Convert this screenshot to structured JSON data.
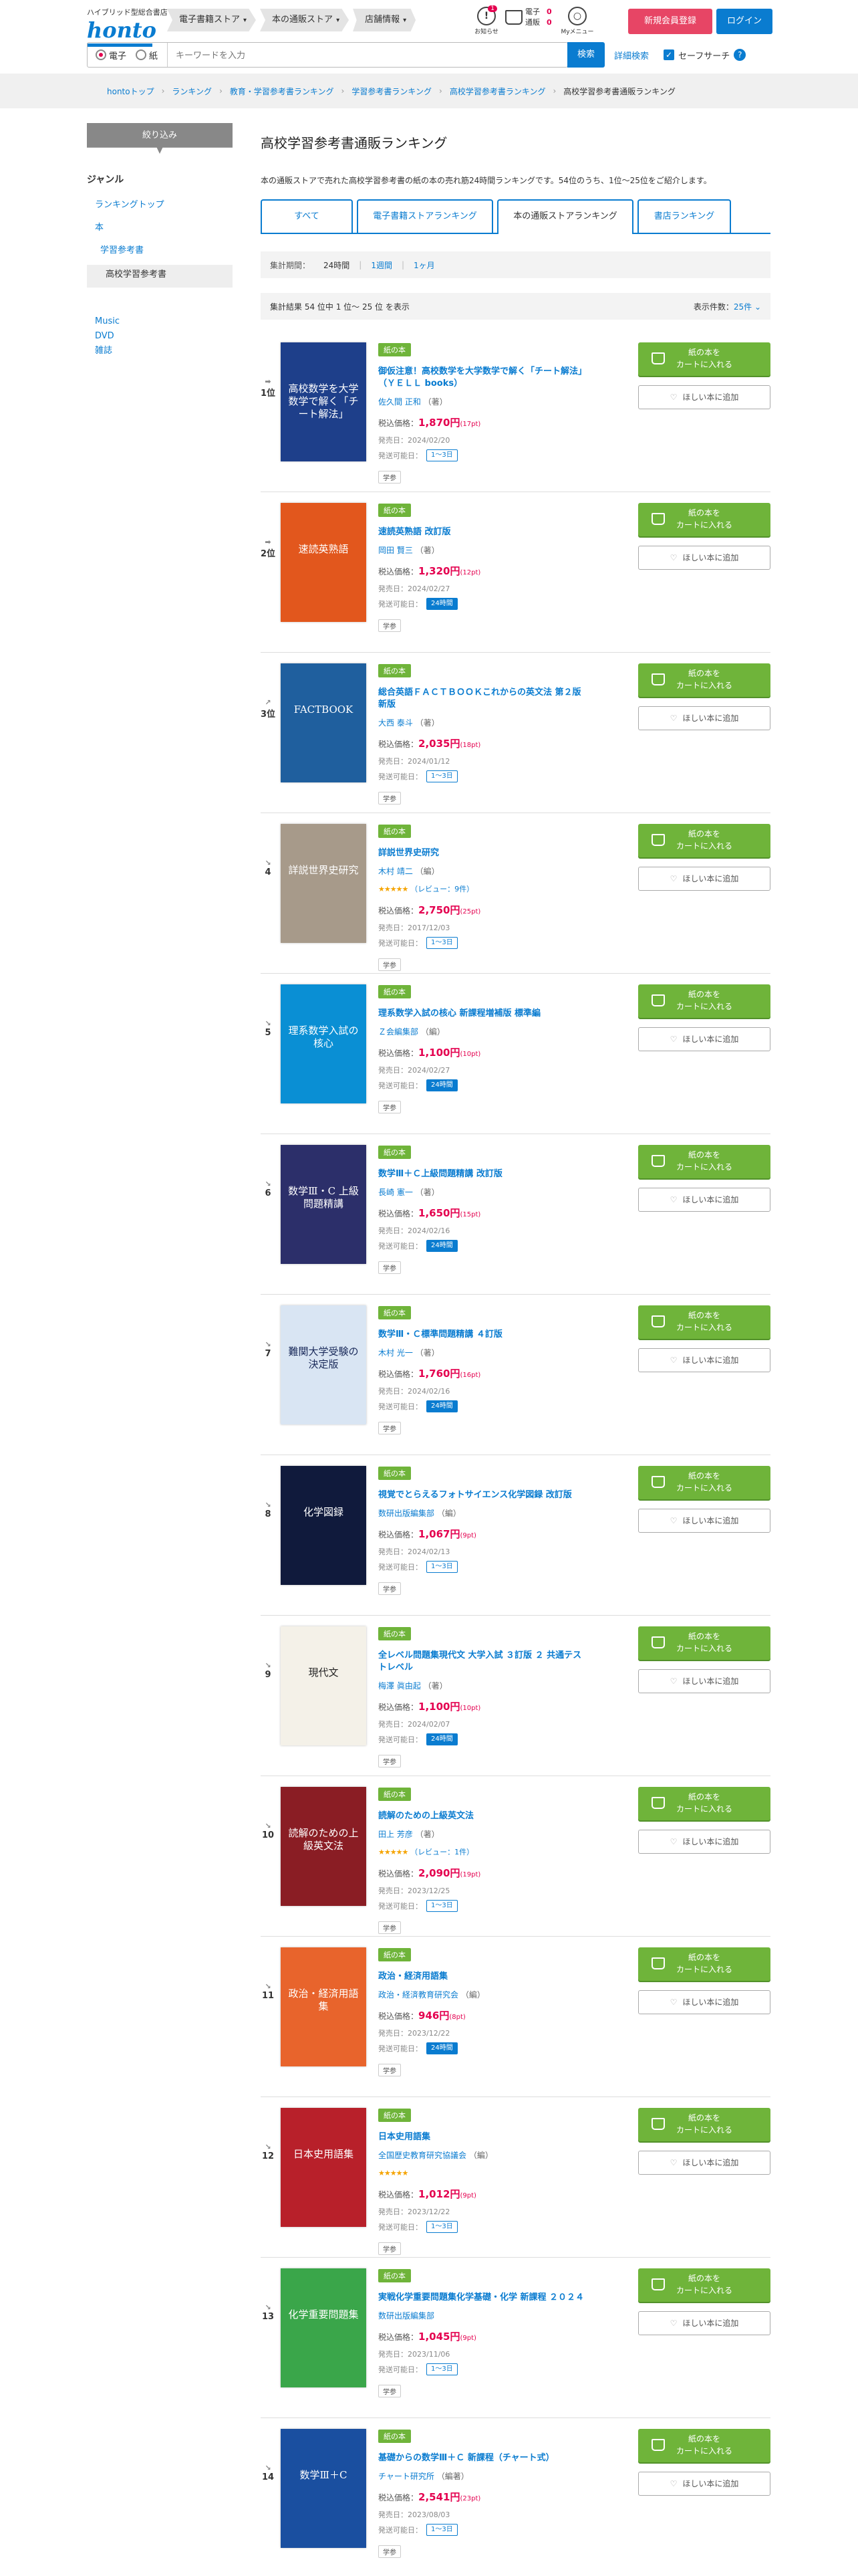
{
  "header": {
    "tagline": "ハイブリッド型総合書店",
    "logo": "honto",
    "tabs": [
      "電子書籍ストア",
      "本の通販ストア",
      "店舗情報"
    ],
    "notice_label": "お知らせ",
    "notice_count": "1",
    "cart_label_1": "電子",
    "cart_label_2": "通販",
    "cart_count_1": "0",
    "cart_count_2": "0",
    "mymenu_label": "Myメニュー",
    "register": "新規会員登録",
    "login": "ログイン",
    "radio_1": "電子",
    "radio_2": "紙",
    "search_placeholder": "キーワードを入力",
    "search_button": "検索",
    "advanced": "詳細検索",
    "safe_search": "セーフサーチ",
    "help": "?"
  },
  "breadcrumb": [
    "hontoトップ",
    "ランキング",
    "教育・学習参考書ランキング",
    "学習参考書ランキング",
    "高校学習参考書ランキング",
    "高校学習参考書通販ランキング"
  ],
  "sidebar": {
    "narrow": "絞り込み",
    "genre": "ジャンル",
    "top": "ランキングトップ",
    "book": "本",
    "study": "学習参考書",
    "current": "高校学習参考書",
    "music": "Music",
    "dvd": "DVD",
    "magazine": "雑誌"
  },
  "main": {
    "title": "高校学習参考書通販ランキング",
    "intro": "本の通販ストアで売れた高校学習参考書の紙の本の売れ筋24時間ランキングです。54位のうち、1位〜25位をご紹介します。",
    "tabs": [
      "すべて",
      "電子書籍ストアランキング",
      "本の通販ストアランキング",
      "書店ランキング"
    ],
    "period_label": "集計期間：",
    "period_current": "24時間",
    "period_week": "1週間",
    "period_month": "1ヶ月",
    "count_text": "集計結果 54 位中 1 位〜 25 位 を表示",
    "display_label": "表示件数：",
    "display_value": "25件"
  },
  "labels": {
    "paper": "紙の本",
    "cart_1": "紙の本を",
    "cart_2": "カートに入れる",
    "wish": "ほしい本に追加",
    "price": "税込価格：",
    "release": "発売日：",
    "ship": "発送可能日：",
    "tag": "学参"
  },
  "items": [
    {
      "rank": "1位",
      "arrow": "➡",
      "title": "御仮注意！高校数学を大学数学で解く「チート解法」（ＹＥＬＬ books）",
      "author": "佐久間 正和",
      "role": "（著）",
      "price": "1,870円",
      "pt": "(17pt)",
      "date": "2024/02/20",
      "ship": "1〜3日",
      "fast": false,
      "cover_bg": "#1e3f8a",
      "cover_text": "高校数学を大学数学で解く「チート解法」",
      "cover_fg": "#ffffff"
    },
    {
      "rank": "2位",
      "arrow": "➡",
      "title": "速読英熟語 改訂版",
      "author": "岡田 賢三",
      "role": "（著）",
      "price": "1,320円",
      "pt": "(12pt)",
      "date": "2024/02/27",
      "ship": "24時間",
      "fast": true,
      "cover_bg": "#e2571d",
      "cover_text": "速読英熟語",
      "cover_fg": "#ffffff"
    },
    {
      "rank": "3位",
      "arrow": "↗",
      "title": "総合英語ＦＡＣＴＢＯＯＫこれからの英文法 第２版新版",
      "author": "大西 泰斗",
      "role": "（著）",
      "price": "2,035円",
      "pt": "(18pt)",
      "date": "2024/01/12",
      "ship": "1〜3日",
      "fast": false,
      "cover_bg": "#1f5f9e",
      "cover_text": "FACTBOOK",
      "cover_fg": "#ffffff"
    },
    {
      "rank": "4",
      "arrow": "↘",
      "title": "詳説世界史研究",
      "author": "木村 靖二",
      "role": "（編）",
      "review": "（レビュー：9件）",
      "price": "2,750円",
      "pt": "(25pt)",
      "date": "2017/12/03",
      "ship": "1〜3日",
      "fast": false,
      "cover_bg": "#a79a8a",
      "cover_text": "詳説世界史研究",
      "cover_fg": "#ffffff"
    },
    {
      "rank": "5",
      "arrow": "↘",
      "title": "理系数学入試の核心 新課程増補版 標準編",
      "author": "Ｚ会編集部",
      "role": "（編）",
      "price": "1,100円",
      "pt": "(10pt)",
      "date": "2024/02/27",
      "ship": "24時間",
      "fast": true,
      "cover_bg": "#0a8fd4",
      "cover_text": "理系数学入試の核心",
      "cover_fg": "#ffffff"
    },
    {
      "rank": "6",
      "arrow": "↘",
      "title": "数学Ⅲ＋Ｃ上級問題精講 改訂版",
      "author": "長崎 憲一",
      "role": "（著）",
      "price": "1,650円",
      "pt": "(15pt)",
      "date": "2024/02/16",
      "ship": "24時間",
      "fast": true,
      "cover_bg": "#2c2f6a",
      "cover_text": "数学Ⅲ・C 上級問題精講",
      "cover_fg": "#ffffff"
    },
    {
      "rank": "7",
      "arrow": "↘",
      "title": "数学Ⅲ・Ｃ標準問題精講 ４訂版",
      "author": "木村 光一",
      "role": "（著）",
      "price": "1,760円",
      "pt": "(16pt)",
      "date": "2024/02/16",
      "ship": "24時間",
      "fast": true,
      "cover_bg": "#d9e5f3",
      "cover_text": "難関大学受験の決定版",
      "cover_fg": "#1a2a5a"
    },
    {
      "rank": "8",
      "arrow": "↘",
      "title": "視覚でとらえるフォトサイエンス化学図録 改訂版",
      "author": "数研出版編集部",
      "role": "（編）",
      "price": "1,067円",
      "pt": "(9pt)",
      "date": "2024/02/13",
      "ship": "1〜3日",
      "fast": false,
      "cover_bg": "#101a3c",
      "cover_text": "化学図録",
      "cover_fg": "#ffffff"
    },
    {
      "rank": "9",
      "arrow": "↘",
      "title": "全レベル問題集現代文 大学入試 ３訂版 ２ 共通テストレベル",
      "author": "梅澤 眞由起",
      "role": "（著）",
      "price": "1,100円",
      "pt": "(10pt)",
      "date": "2024/02/07",
      "ship": "24時間",
      "fast": true,
      "cover_bg": "#f4f1e8",
      "cover_text": "現代文",
      "cover_fg": "#222222"
    },
    {
      "rank": "10",
      "arrow": "↘",
      "title": "読解のための上級英文法",
      "author": "田上 芳彦",
      "role": "（著）",
      "review": "（レビュー：1件）",
      "price": "2,090円",
      "pt": "(19pt)",
      "date": "2023/12/25",
      "ship": "1〜3日",
      "fast": false,
      "cover_bg": "#8a1d24",
      "cover_text": "読解のための上級英文法",
      "cover_fg": "#ffffff"
    },
    {
      "rank": "11",
      "arrow": "↘",
      "title": "政治・経済用語集",
      "author": "政治・経済教育研究会",
      "role": "（編）",
      "price": "946円",
      "pt": "(8pt)",
      "date": "2023/12/22",
      "ship": "24時間",
      "fast": true,
      "cover_bg": "#e8642c",
      "cover_text": "政治・経済用語集",
      "cover_fg": "#ffffff"
    },
    {
      "rank": "12",
      "arrow": "↘",
      "title": "日本史用語集",
      "author": "全国歴史教育研究協議会",
      "role": "（編）",
      "stars_only": true,
      "price": "1,012円",
      "pt": "(9pt)",
      "date": "2023/12/22",
      "ship": "1〜3日",
      "fast": false,
      "cover_bg": "#b8202a",
      "cover_text": "日本史用語集",
      "cover_fg": "#ffffff"
    },
    {
      "rank": "13",
      "arrow": "↘",
      "title": "実戦化学重要問題集化学基礎・化学 新課程 ２０２４",
      "author": "数研出版編集部",
      "role": "",
      "price": "1,045円",
      "pt": "(9pt)",
      "date": "2023/11/06",
      "ship": "1〜3日",
      "fast": false,
      "cover_bg": "#3aa64a",
      "cover_text": "化学重要問題集",
      "cover_fg": "#ffffff"
    },
    {
      "rank": "14",
      "arrow": "↘",
      "title": "基礎からの数学Ⅲ＋Ｃ 新課程（チャート式）",
      "author": "チャート研究所",
      "role": "（編著）",
      "price": "2,541円",
      "pt": "(23pt)",
      "date": "2023/08/03",
      "ship": "1〜3日",
      "fast": false,
      "cover_bg": "#1a4fa0",
      "cover_text": "数学Ⅲ＋C",
      "cover_fg": "#ffffff"
    }
  ]
}
